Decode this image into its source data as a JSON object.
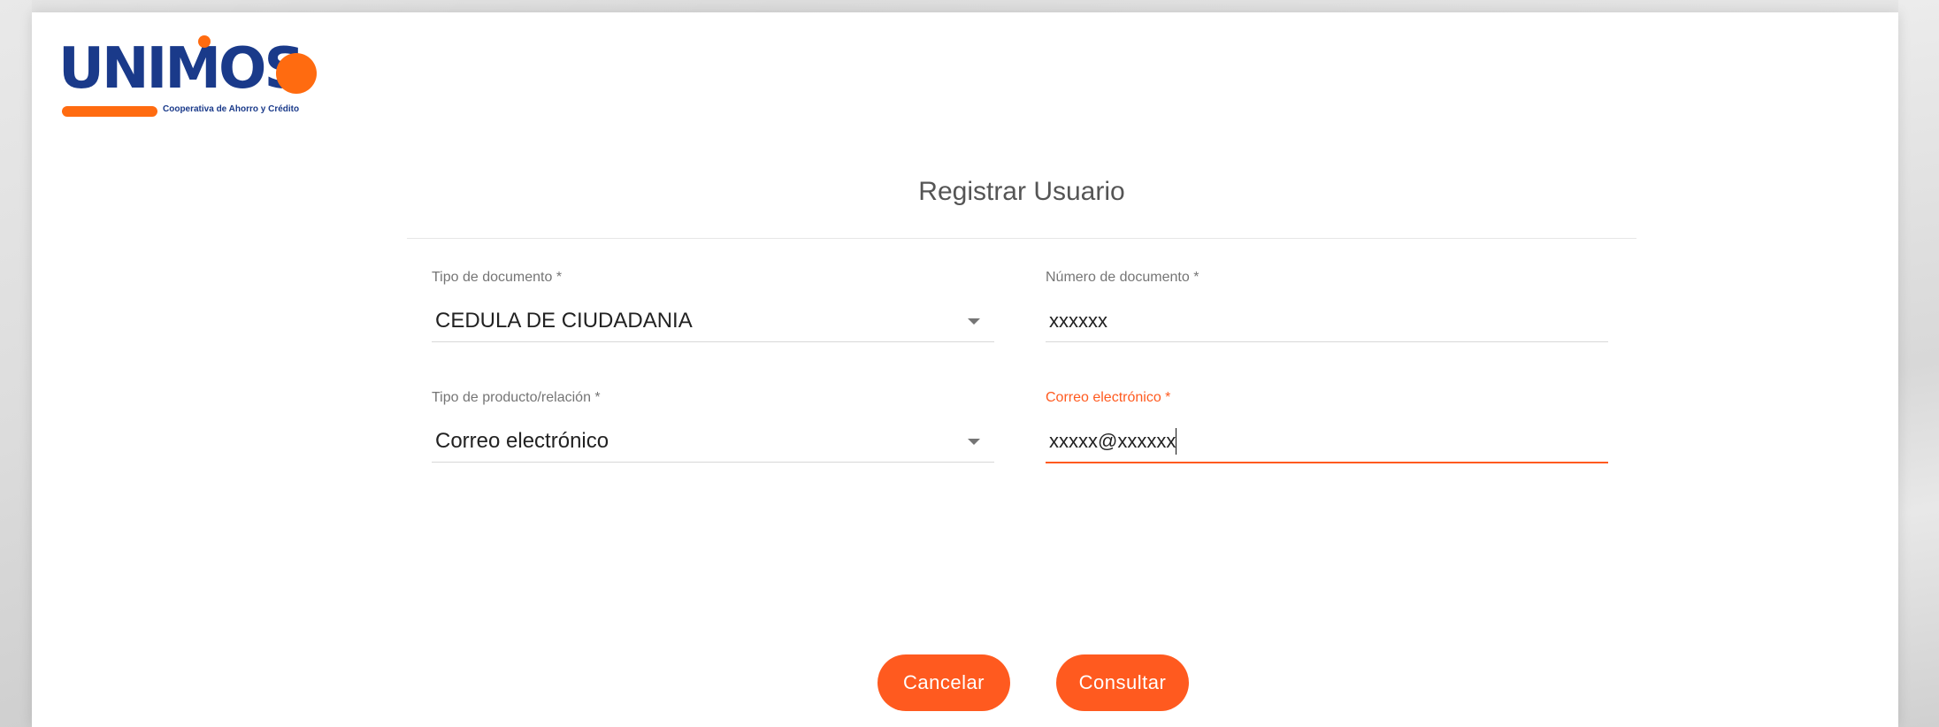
{
  "logo": {
    "wordmark": "UNIMOS",
    "tagline": "Cooperativa de Ahorro y Crédito"
  },
  "page": {
    "title": "Registrar Usuario"
  },
  "form": {
    "document_type": {
      "label": "Tipo de documento *",
      "value": "CEDULA DE CIUDADANIA"
    },
    "document_number": {
      "label": "Número de documento *",
      "value": "xxxxxx"
    },
    "product_relation": {
      "label": "Tipo de producto/relación *",
      "value": "Correo electrónico"
    },
    "email": {
      "label": "Correo electrónico *",
      "value": "xxxxx@xxxxxx"
    }
  },
  "actions": {
    "cancel_label": "Cancelar",
    "submit_label": "Consultar"
  },
  "colors": {
    "accent": "#ff5a1f",
    "brand_blue": "#1a3a8a",
    "brand_orange": "#ff6b10"
  }
}
